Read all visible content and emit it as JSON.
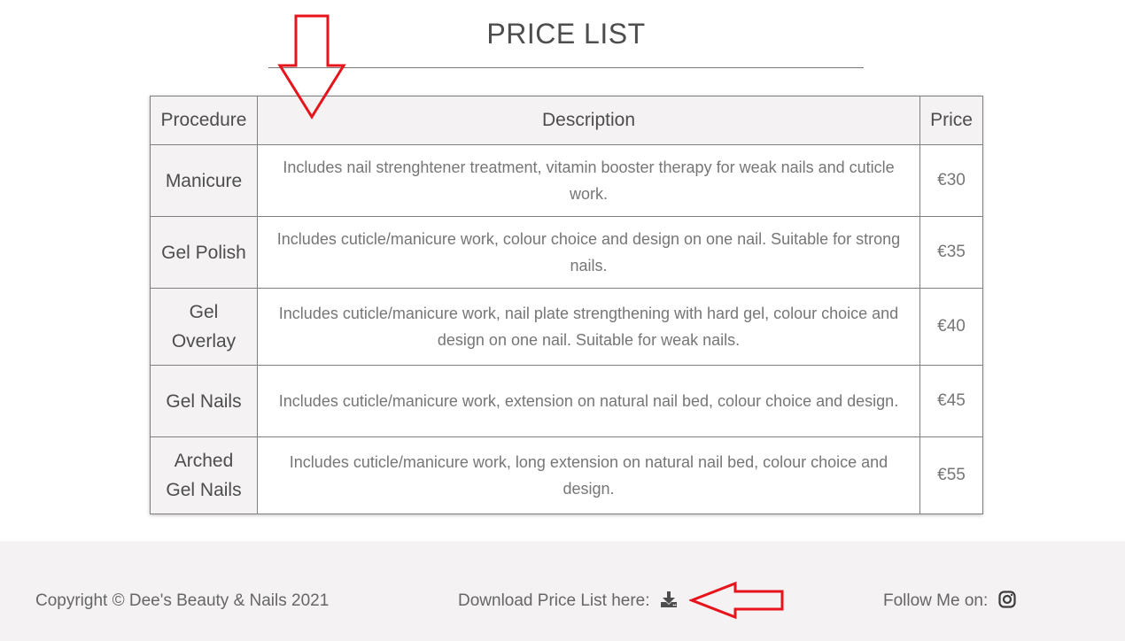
{
  "page": {
    "title": "PRICE LIST"
  },
  "table": {
    "headers": {
      "procedure": "Procedure",
      "description": "Description",
      "price": "Price"
    },
    "rows": [
      {
        "procedure": "Manicure",
        "description": "Includes nail strenghtener treatment, vitamin booster therapy for weak nails and cuticle work.",
        "price": "€30"
      },
      {
        "procedure": "Gel Polish",
        "description": "Includes cuticle/manicure work, colour choice and design on one nail. Suitable for strong nails.",
        "price": "€35"
      },
      {
        "procedure": "Gel Overlay",
        "description": "Includes cuticle/manicure work, nail plate strengthening with hard gel, colour choice and design on one nail. Suitable for weak nails.",
        "price": "€40"
      },
      {
        "procedure": "Gel Nails",
        "description": "Includes cuticle/manicure work, extension on natural nail bed, colour choice and design.",
        "price": "€45"
      },
      {
        "procedure": "Arched Gel Nails",
        "description": "Includes cuticle/manicure work, long extension on natural nail bed, colour choice and design.",
        "price": "€55"
      }
    ]
  },
  "footer": {
    "copyright": "Copyright © Dee's Beauty & Nails 2021",
    "download_label": "Download Price List here:",
    "follow_label": "Follow Me on:",
    "download_icon": "download-icon",
    "instagram_icon": "instagram-icon"
  },
  "annotations": {
    "arrow_color": "#e8141c"
  }
}
